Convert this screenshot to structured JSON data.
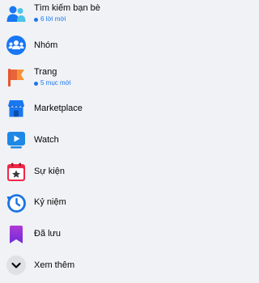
{
  "nav": {
    "items": [
      {
        "label": "Tìm kiếm bạn bè",
        "badge": "6 lời mời",
        "icon": "friends-icon"
      },
      {
        "label": "Nhóm",
        "icon": "groups-icon"
      },
      {
        "label": "Trang",
        "badge": "5 mục mới",
        "icon": "pages-flag-icon"
      },
      {
        "label": "Marketplace",
        "icon": "marketplace-icon"
      },
      {
        "label": "Watch",
        "icon": "watch-icon"
      },
      {
        "label": "Sự kiện",
        "icon": "events-calendar-icon"
      },
      {
        "label": "Kỷ niệm",
        "icon": "memories-clock-icon"
      },
      {
        "label": "Đã lưu",
        "icon": "saved-bookmark-icon"
      },
      {
        "label": "Xem thêm",
        "icon": "chevron-down-icon"
      }
    ]
  },
  "colors": {
    "background": "#f0f2f5",
    "badge": "#1877f2"
  }
}
